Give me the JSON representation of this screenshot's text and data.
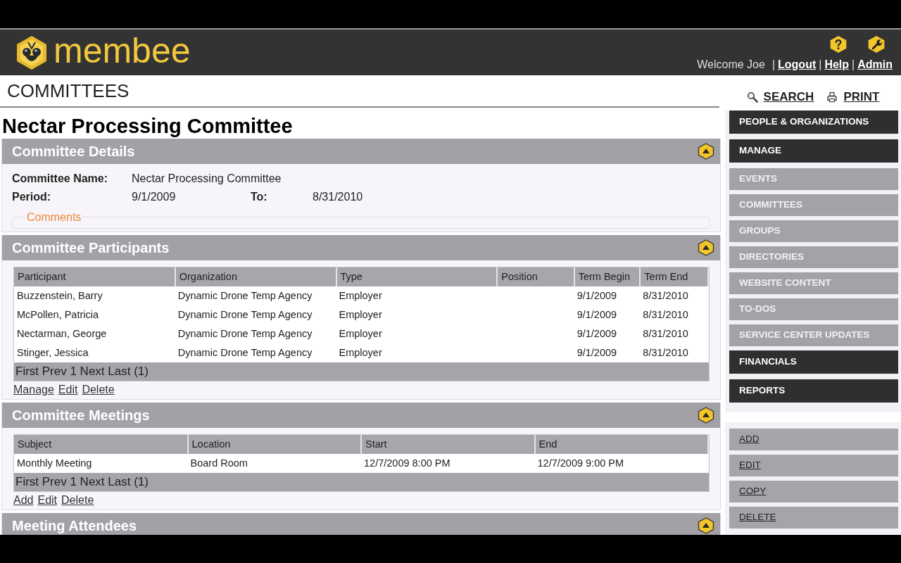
{
  "header": {
    "logo_text": "membee",
    "items": [
      {
        "kind": "text",
        "label": "Welcome Joe"
      },
      {
        "kind": "separator",
        "label": "|"
      },
      {
        "kind": "link",
        "label": "Logout"
      },
      {
        "kind": "separator",
        "label": "|"
      },
      {
        "kind": "link",
        "label": "Help"
      },
      {
        "kind": "separator",
        "label": "|"
      },
      {
        "kind": "link",
        "label": "Admin"
      }
    ]
  },
  "page_title": "COMMITTEES",
  "record_title": "Nectar Processing Committee",
  "sections": [
    {
      "kind": "details",
      "title": "Committee Details",
      "rows": [
        {
          "fields": [
            {
              "label": "Committee Name:",
              "value": "Nectar Processing Committee"
            }
          ]
        },
        {
          "fields": [
            {
              "label": "Period:",
              "value": "9/1/2009"
            },
            {
              "label": "To:",
              "value": "8/31/2010"
            }
          ]
        }
      ],
      "comments_legend": "Comments"
    },
    {
      "kind": "table",
      "title": "Committee Participants",
      "columns": [
        "Participant",
        "Organization",
        "Type",
        "Position",
        "Term Begin",
        "Term End"
      ],
      "rows": [
        [
          "Buzzenstein, Barry",
          "Dynamic Drone Temp Agency",
          "Employer",
          "",
          "9/1/2009",
          "8/31/2010"
        ],
        [
          "McPollen, Patricia",
          "Dynamic Drone Temp Agency",
          "Employer",
          "",
          "9/1/2009",
          "8/31/2010"
        ],
        [
          "Nectarman, George",
          "Dynamic Drone Temp Agency",
          "Employer",
          "",
          "9/1/2009",
          "8/31/2010"
        ],
        [
          "Stinger, Jessica",
          "Dynamic Drone Temp Agency",
          "Employer",
          "",
          "9/1/2009",
          "8/31/2010"
        ]
      ],
      "pager": "First Prev 1 Next Last (1)",
      "links": [
        "Manage",
        "Edit",
        "Delete"
      ]
    },
    {
      "kind": "table",
      "title": "Committee Meetings",
      "columns": [
        "Subject",
        "Location",
        "Start",
        "End"
      ],
      "rows": [
        [
          "Monthly Meeting",
          "Board Room",
          "12/7/2009 8:00 PM",
          "12/7/2009 9:00 PM"
        ]
      ],
      "pager": "First Prev 1 Next Last (1)",
      "links": [
        "Add",
        "Edit",
        "Delete"
      ]
    },
    {
      "title": "Meeting Attendees"
    }
  ],
  "sidebar": {
    "tools": [
      {
        "kind": "search",
        "label": "SEARCH"
      },
      {
        "kind": "print",
        "label": "PRINT"
      }
    ],
    "nav": [
      {
        "kind": "category",
        "label": "PEOPLE & ORGANIZATIONS"
      },
      {
        "kind": "category",
        "label": "MANAGE"
      },
      {
        "kind": "item",
        "label": "EVENTS"
      },
      {
        "kind": "item",
        "label": "COMMITTEES"
      },
      {
        "kind": "item",
        "label": "GROUPS"
      },
      {
        "kind": "item",
        "label": "DIRECTORIES"
      },
      {
        "kind": "item",
        "label": "WEBSITE CONTENT"
      },
      {
        "kind": "item",
        "label": "TO-DOS"
      },
      {
        "kind": "item",
        "label": "SERVICE CENTER UPDATES"
      },
      {
        "kind": "category",
        "label": "FINANCIALS"
      },
      {
        "kind": "category",
        "label": "REPORTS"
      }
    ],
    "actions": [
      "ADD",
      "EDIT",
      "COPY",
      "DELETE"
    ]
  }
}
